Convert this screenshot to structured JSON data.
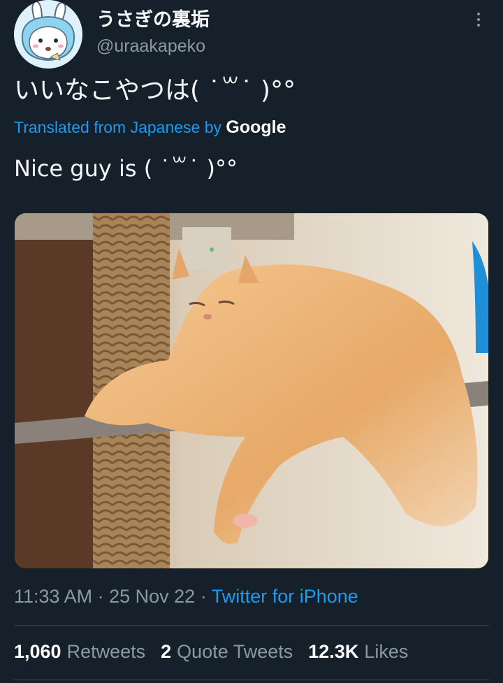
{
  "author": {
    "display_name": "うさぎの裏垢",
    "handle": "@uraakapeko",
    "avatar_icon": "bunny-avatar-icon"
  },
  "tweet": {
    "text": "いいなこやつは( ˙꒳˙ )°°",
    "translated_label": "Translated from Japanese by",
    "translator": "Google",
    "translation": "Nice guy is ( ˙꒳˙ )°°"
  },
  "media": {
    "icon": "cat-photo"
  },
  "meta": {
    "time": "11:33 AM",
    "date": "25 Nov 22",
    "separator": "·",
    "source": "Twitter for iPhone"
  },
  "stats": {
    "retweets_count": "1,060",
    "retweets_label": "Retweets",
    "quotes_count": "2",
    "quotes_label": "Quote Tweets",
    "likes_count": "12.3K",
    "likes_label": "Likes"
  },
  "colors": {
    "background": "#15202b",
    "accent": "#1d9bf0",
    "secondary_text": "#8b98a5"
  }
}
